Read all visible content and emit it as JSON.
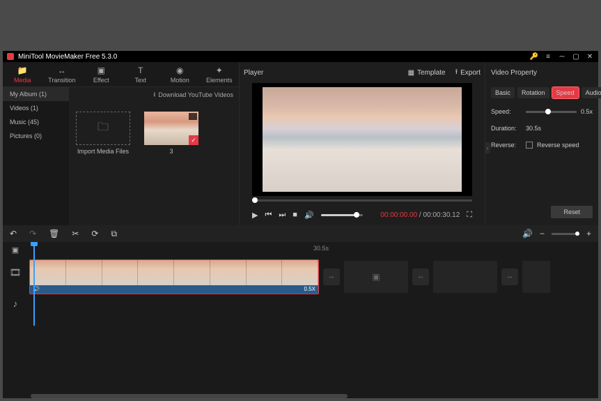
{
  "titlebar": {
    "title": "MiniTool MovieMaker Free 5.3.0"
  },
  "top_tabs": [
    {
      "label": "Media",
      "icon": "📁",
      "active": true
    },
    {
      "label": "Transition",
      "icon": "↔",
      "active": false
    },
    {
      "label": "Effect",
      "icon": "▣",
      "active": false
    },
    {
      "label": "Text",
      "icon": "T",
      "active": false
    },
    {
      "label": "Motion",
      "icon": "◉",
      "active": false
    },
    {
      "label": "Elements",
      "icon": "✦",
      "active": false
    }
  ],
  "media_sidebar": [
    {
      "label": "My Album (1)",
      "active": true
    },
    {
      "label": "Videos (1)",
      "active": false
    },
    {
      "label": "Music (45)",
      "active": false
    },
    {
      "label": "Pictures (0)",
      "active": false
    }
  ],
  "download_label": "Download YouTube Videos",
  "import_label": "Import Media Files",
  "thumb1_label": "3",
  "player": {
    "title": "Player",
    "template": "Template",
    "export": "Export",
    "time_current": "00:00:00.00",
    "time_sep": " / ",
    "time_total": "00:00:30.12"
  },
  "prop": {
    "title": "Video Property",
    "tabs": [
      "Basic",
      "Rotation",
      "Speed",
      "Audio"
    ],
    "active_tab": 2,
    "speed_label": "Speed:",
    "speed_value": "0.5x",
    "duration_label": "Duration:",
    "duration_value": "30.5s",
    "reverse_label": "Reverse:",
    "reverse_cb_label": "Reverse speed",
    "reset": "Reset"
  },
  "ruler_label": "30.5s",
  "clip_speed_badge": "0.5X"
}
